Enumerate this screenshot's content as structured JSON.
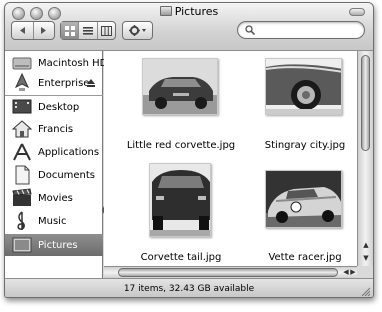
{
  "window": {
    "title": "Pictures",
    "status": "17 items, 32.43 GB available"
  },
  "toolbar": {
    "back_icon": "back-arrow-icon",
    "forward_icon": "forward-arrow-icon",
    "views": [
      "icon-view",
      "list-view",
      "column-view"
    ],
    "active_view": "icon-view",
    "action_icon": "gear-icon",
    "search_placeholder": ""
  },
  "sidebar": {
    "devices": [
      {
        "label": "Macintosh HD",
        "icon": "hard-drive-icon"
      },
      {
        "label": "Enterprise",
        "icon": "network-drive-icon",
        "eject": true
      }
    ],
    "places": [
      {
        "label": "Desktop",
        "icon": "desktop-icon"
      },
      {
        "label": "Francis",
        "icon": "home-icon"
      },
      {
        "label": "Applications",
        "icon": "applications-icon"
      },
      {
        "label": "Documents",
        "icon": "documents-icon"
      },
      {
        "label": "Movies",
        "icon": "movies-icon"
      },
      {
        "label": "Music",
        "icon": "music-icon"
      },
      {
        "label": "Pictures",
        "icon": "pictures-icon",
        "selected": true
      }
    ]
  },
  "files": [
    {
      "name": "Little red corvette.jpg",
      "kind": "car-front"
    },
    {
      "name": "Stingray city.jpg",
      "kind": "car-wheel"
    },
    {
      "name": "Corvette tail.jpg",
      "kind": "car-tail"
    },
    {
      "name": "Vette racer.jpg",
      "kind": "race-car"
    }
  ],
  "colors": {
    "selection": "#7a7a7a",
    "chrome": "#d9d9d9"
  }
}
